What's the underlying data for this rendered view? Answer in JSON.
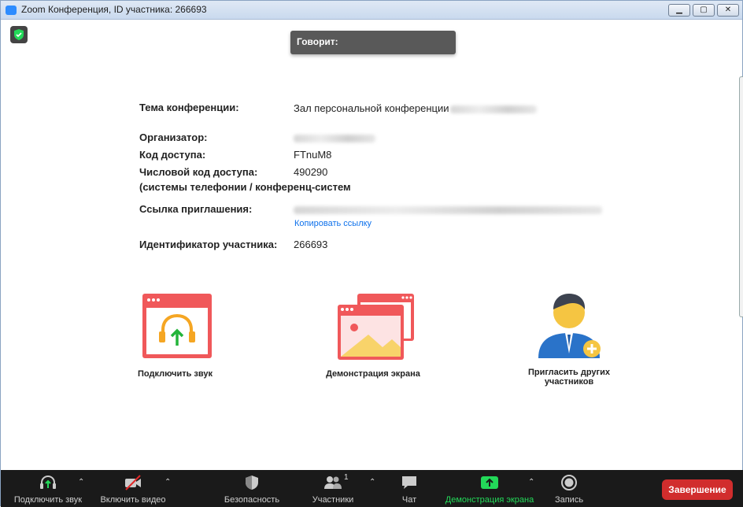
{
  "window": {
    "title": "Zoom Конференция, ID участника: 266693",
    "min_glyph": "▁",
    "max_glyph": "▢",
    "close_glyph": "✕"
  },
  "speaking": {
    "label": "Говорит:"
  },
  "info": {
    "topic_label": "Тема конференции:",
    "topic_value": "Зал персональной конференции",
    "organizer_label": "Организатор:",
    "passcode_label": "Код доступа:",
    "passcode_value": "FTnuM8",
    "numeric_label": "Числовой код доступа:",
    "numeric_value": "490290",
    "numeric_note": "(системы телефонии / конференц-систем",
    "invite_label": "Ссылка приглашения:",
    "copy_link": "Копировать ссылку",
    "participant_label": "Идентификатор участника:",
    "participant_value": "266693"
  },
  "actions": {
    "audio": "Подключить звук",
    "share": "Демонстрация экрана",
    "invite_line1": "Пригласить других",
    "invite_line2": "участников"
  },
  "toolbar": {
    "audio": "Подключить звук",
    "video": "Включить видео",
    "security": "Безопасность",
    "participants": "Участники",
    "participants_count": "1",
    "chat": "Чат",
    "share": "Демонстрация экрана",
    "record": "Запись",
    "end": "Завершение"
  },
  "colors": {
    "accent_red": "#f0585a",
    "toolbar_bg": "#1a1a1a",
    "share_green": "#23d959",
    "end_red": "#d12d2d",
    "link_blue": "#0e71eb"
  }
}
